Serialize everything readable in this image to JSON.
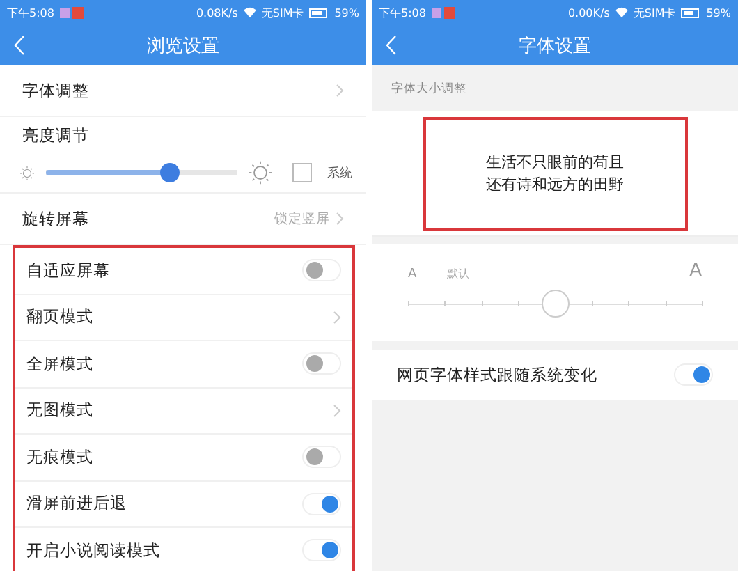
{
  "browse_settings": {
    "status_bar": {
      "time": "下午5:08",
      "speed": "0.08K/s",
      "sim": "无SIM卡",
      "battery": "59%"
    },
    "header": {
      "title": "浏览设置"
    },
    "rows": [
      {
        "kind": "link",
        "label": "字体调整"
      },
      {
        "kind": "heading",
        "label": "亮度调节"
      },
      {
        "kind": "brightness",
        "level": 0.65,
        "checkbox_label": "系统",
        "checked": false
      },
      {
        "kind": "link",
        "label": "旋转屏幕",
        "value": "锁定竖屏"
      }
    ],
    "highlighted_rows": [
      {
        "kind": "toggle",
        "label": "自适应屏幕",
        "on": false
      },
      {
        "kind": "link",
        "label": "翻页模式"
      },
      {
        "kind": "toggle",
        "label": "全屏模式",
        "on": false
      },
      {
        "kind": "link",
        "label": "无图模式"
      },
      {
        "kind": "toggle",
        "label": "无痕模式",
        "on": false
      },
      {
        "kind": "toggle",
        "label": "滑屏前进后退",
        "on": true
      },
      {
        "kind": "toggle",
        "label": "开启小说阅读模式",
        "on": true
      }
    ]
  },
  "font_settings": {
    "status_bar": {
      "time": "下午5:08",
      "speed": "0.00K/s",
      "sim": "无SIM卡",
      "battery": "59%"
    },
    "header": {
      "title": "字体设置"
    },
    "section_label": "字体大小调整",
    "preview": {
      "lines": [
        "生活不只眼前的苟且",
        "还有诗和远方的田野"
      ],
      "highlighted": true
    },
    "size_slider": {
      "small_label": "A",
      "default_label": "默认",
      "large_label": "A",
      "level": 0.5
    },
    "follow_system": {
      "label": "网页字体样式跟随系统变化",
      "on": true
    }
  }
}
